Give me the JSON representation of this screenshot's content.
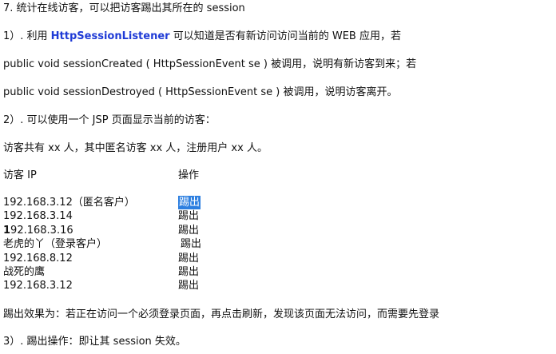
{
  "section_title": "7. 统计在线访客，可以把访客踢出其所在的 session",
  "point1": {
    "prefix": "1）. 利用 ",
    "class_name": "HttpSessionListener",
    "suffix": " 可以知道是否有新访问访问当前的 WEB 应用，若"
  },
  "created_line": " public void sessionCreated ( HttpSessionEvent se ) 被调用，说明有新访客到来；若",
  "destroyed_line": " public void sessionDestroyed ( HttpSessionEvent se ) 被调用，说明访客离开。",
  "point2": "2）. 可以使用一个 JSP 页面显示当前的访客：",
  "summary_line": "访客共有 xx 人，其中匿名访客 xx 人，注册用户 xx 人。",
  "table": {
    "header_ip": "访客 IP",
    "header_action": "操作",
    "rows": [
      {
        "ip": "192.168.3.12（匿名客户）",
        "action": "踢出"
      },
      {
        "ip": "192.168.3.14",
        "action": "踢出"
      },
      {
        "ip": "192.168.3.16",
        "action": "踢出"
      },
      {
        "ip": "老虎的丫（登录客户）",
        "action": "踢出"
      },
      {
        "ip": "192.168.8.12",
        "action": "踢出"
      },
      {
        "ip": "战死的鹰",
        "action": "踢出"
      },
      {
        "ip": "192.168.3.12",
        "action": "踢出"
      }
    ]
  },
  "kick_effect": "踢出效果为：若正在访问一个必须登录页面，再点击刷新，发现该页面无法访问，而需要先登录",
  "point3": "3）. 踢出操作：即让其 session 失效。",
  "colors": {
    "highlight_text": "#1f3bd6",
    "selection_bg": "#2d7fe0"
  }
}
